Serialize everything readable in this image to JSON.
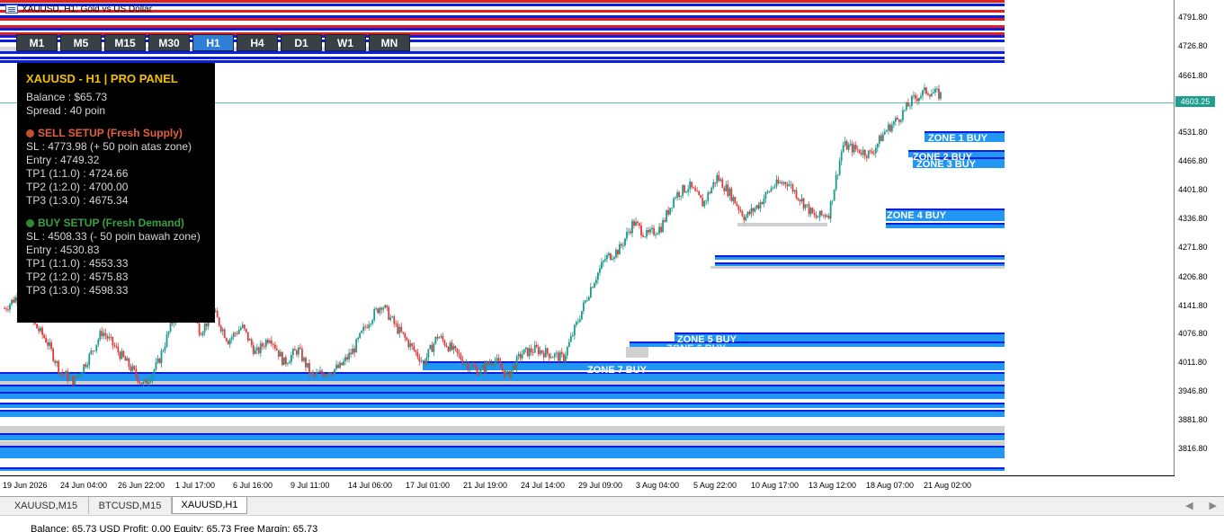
{
  "window": {
    "title": "XAUUSD, H1:  Gold vs US Dollar"
  },
  "timeframes": [
    "M1",
    "M5",
    "M15",
    "M30",
    "H1",
    "H4",
    "D1",
    "W1",
    "MN"
  ],
  "active_timeframe": "H1",
  "panel": {
    "title": "XAUUSD - H1 | PRO PANEL",
    "balance": "Balance : $65.73",
    "spread": "Spread  : 40 poin",
    "sell": {
      "heading": "SELL SETUP (Fresh Supply)",
      "color": "#e06040",
      "lines": [
        "SL : 4773.98 (+ 50 poin atas zone)",
        "Entry : 4749.32",
        "TP1 (1:1.0) : 4724.66",
        "TP2 (1:2.0) : 4700.00",
        "TP3 (1:3.0) : 4675.34"
      ]
    },
    "buy": {
      "heading": "BUY SETUP (Fresh Demand)",
      "color": "#3aa040",
      "lines": [
        "SL : 4508.33 (- 50 poin bawah zone)",
        "Entry : 4530.83",
        "TP1 (1:1.0) : 4553.33",
        "TP2 (1:2.0) : 4575.83",
        "TP3 (1:3.0) : 4598.33"
      ]
    }
  },
  "price_axis": [
    "4791.80",
    "4726.80",
    "4661.80",
    "4596.80",
    "4531.80",
    "4466.80",
    "4401.80",
    "4336.80",
    "4271.80",
    "4206.80",
    "4141.80",
    "4076.80",
    "4011.80",
    "3946.80",
    "3881.80",
    "3816.80"
  ],
  "current_price": "4603.25",
  "time_axis": [
    "19 Jun 2026",
    "24 Jun 04:00",
    "26 Jun 22:00",
    "1 Jul 17:00",
    "6 Jul 16:00",
    "9 Jul 11:00",
    "14 Jul 06:00",
    "17 Jul 01:00",
    "21 Jul 19:00",
    "24 Jul 14:00",
    "29 Jul 09:00",
    "3 Aug 04:00",
    "5 Aug 22:00",
    "10 Aug 17:00",
    "13 Aug 12:00",
    "18 Aug 07:00",
    "21 Aug 02:00"
  ],
  "zones": [
    {
      "label": "ZONE 1 BUY"
    },
    {
      "label": "ZONE 2 BUY"
    },
    {
      "label": "ZONE 3 BUY"
    },
    {
      "label": "ZONE 4 BUY"
    },
    {
      "label": "ZONE 5 BUY"
    },
    {
      "label": "ZONE 6 BUY"
    },
    {
      "label": "ZONE 7 BUY"
    }
  ],
  "chart_tabs": [
    "XAUUSD,M15",
    "BTCUSD,M15",
    "XAUUSD,H1"
  ],
  "active_chart_tab": "XAUUSD,H1",
  "status_text": "Balance: 65.73 USD  Profit: 0.00  Equity: 65.73  Free Margin: 65.73",
  "colors": {
    "zone_blue": "#0a1ee0",
    "zone_fill": "#2196f3",
    "resist_red": "#e02020",
    "bull": "#1a9a8a",
    "bear": "#e03a3a",
    "panel_bg": "#000000"
  },
  "chart_data": {
    "type": "candlestick",
    "symbol": "XAUUSD",
    "timeframe": "H1",
    "ylim": [
      3780,
      4830
    ],
    "x_labels": [
      "19 Jun 2026",
      "24 Jun 04:00",
      "26 Jun 22:00",
      "1 Jul 17:00",
      "6 Jul 16:00",
      "9 Jul 11:00",
      "14 Jul 06:00",
      "17 Jul 01:00",
      "21 Jul 19:00",
      "24 Jul 14:00",
      "29 Jul 09:00",
      "3 Aug 04:00",
      "5 Aug 22:00",
      "10 Aug 17:00",
      "13 Aug 12:00",
      "18 Aug 07:00",
      "21 Aug 02:00"
    ],
    "close_path": [
      4150,
      4180,
      4120,
      4080,
      4010,
      3990,
      4040,
      4100,
      4060,
      4020,
      3980,
      4030,
      4120,
      4170,
      4100,
      4140,
      4080,
      4110,
      4050,
      4090,
      4030,
      4060,
      4000,
      4010,
      4020,
      4060,
      4120,
      4160,
      4110,
      4070,
      4030,
      4090,
      4060,
      4030,
      4010,
      4040,
      4000,
      4050,
      4060,
      4050,
      4040,
      4120,
      4200,
      4260,
      4280,
      4340,
      4310,
      4330,
      4400,
      4420,
      4380,
      4440,
      4400,
      4350,
      4380,
      4420,
      4430,
      4390,
      4350,
      4360,
      4510,
      4500,
      4490,
      4540,
      4570,
      4610,
      4630,
      4620
    ]
  }
}
